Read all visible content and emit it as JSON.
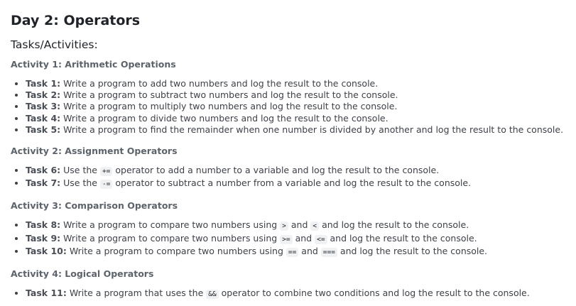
{
  "title": "Day 2: Operators",
  "subtitle": "Tasks/Activities:",
  "activities": [
    {
      "heading": "Activity 1: Arithmetic Operations",
      "tasks": [
        {
          "label": "Task 1:",
          "parts": [
            {
              "t": "text",
              "v": " Write a program to add two numbers and log the result to the console."
            }
          ]
        },
        {
          "label": "Task 2:",
          "parts": [
            {
              "t": "text",
              "v": " Write a program to subtract two numbers and log the result to the console."
            }
          ]
        },
        {
          "label": "Task 3:",
          "parts": [
            {
              "t": "text",
              "v": " Write a program to multiply two numbers and log the result to the console."
            }
          ]
        },
        {
          "label": "Task 4:",
          "parts": [
            {
              "t": "text",
              "v": " Write a program to divide two numbers and log the result to the console."
            }
          ]
        },
        {
          "label": "Task 5:",
          "parts": [
            {
              "t": "text",
              "v": " Write a program to find the remainder when one number is divided by another and log the result to the console."
            }
          ]
        }
      ]
    },
    {
      "heading": "Activity 2: Assignment Operators",
      "tasks": [
        {
          "label": "Task 6:",
          "parts": [
            {
              "t": "text",
              "v": " Use the "
            },
            {
              "t": "code",
              "v": "+="
            },
            {
              "t": "text",
              "v": " operator to add a number to a variable and log the result to the console."
            }
          ]
        },
        {
          "label": "Task 7:",
          "parts": [
            {
              "t": "text",
              "v": " Use the "
            },
            {
              "t": "code",
              "v": "-="
            },
            {
              "t": "text",
              "v": " operator to subtract a number from a variable and log the result to the console."
            }
          ]
        }
      ]
    },
    {
      "heading": "Activity 3: Comparison Operators",
      "tasks": [
        {
          "label": "Task 8:",
          "parts": [
            {
              "t": "text",
              "v": " Write a program to compare two numbers using "
            },
            {
              "t": "code",
              "v": ">"
            },
            {
              "t": "text",
              "v": " and "
            },
            {
              "t": "code",
              "v": "<"
            },
            {
              "t": "text",
              "v": " and log the result to the console."
            }
          ]
        },
        {
          "label": "Task 9:",
          "parts": [
            {
              "t": "text",
              "v": " Write a program to compare two numbers using "
            },
            {
              "t": "code",
              "v": ">="
            },
            {
              "t": "text",
              "v": " and "
            },
            {
              "t": "code",
              "v": "<="
            },
            {
              "t": "text",
              "v": " and log the result to the console."
            }
          ]
        },
        {
          "label": "Task 10:",
          "parts": [
            {
              "t": "text",
              "v": " Write a program to compare two numbers using "
            },
            {
              "t": "code",
              "v": "=="
            },
            {
              "t": "text",
              "v": " and "
            },
            {
              "t": "code",
              "v": "==="
            },
            {
              "t": "text",
              "v": " and log the result to the console."
            }
          ]
        }
      ]
    },
    {
      "heading": "Activity 4: Logical Operators",
      "tasks": [
        {
          "label": "Task 11:",
          "parts": [
            {
              "t": "text",
              "v": " Write a program that uses the "
            },
            {
              "t": "code",
              "v": "&&"
            },
            {
              "t": "text",
              "v": " operator to combine two conditions and log the result to the console."
            }
          ]
        }
      ]
    }
  ]
}
